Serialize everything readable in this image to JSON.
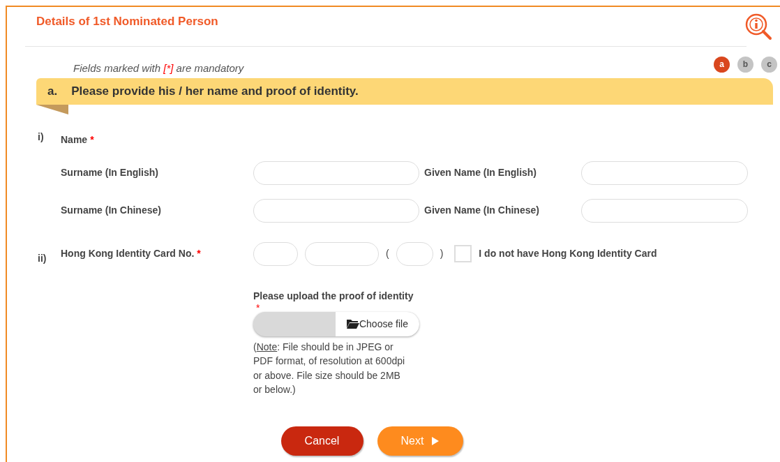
{
  "title": "Details of 1st Nominated Person",
  "mandatory_note": {
    "before": "Fields marked with ",
    "marker": "[*]",
    "after": " are mandatory"
  },
  "steps": [
    {
      "label": "a",
      "selected": true
    },
    {
      "label": "b",
      "selected": false
    },
    {
      "label": "c",
      "selected": false
    }
  ],
  "section": {
    "letter": "a.",
    "heading": "Please provide his / her name and proof of identity."
  },
  "name_group": {
    "number": "i)",
    "label": "Name",
    "required_mark": "*",
    "rows": [
      {
        "label": "Surname (In English)",
        "second_label": "Given Name (In English)"
      },
      {
        "label": "Surname (In Chinese)",
        "second_label": "Given Name (In Chinese)"
      }
    ]
  },
  "id_group": {
    "number": "ii)",
    "label": "Hong Kong Identity Card No.",
    "required_mark": "*",
    "open_paren": "(",
    "close_paren": ")",
    "no_id": {
      "label": "I do not have Hong Kong Identity Card",
      "checked": false
    }
  },
  "upload": {
    "label": "Please upload the proof of identity",
    "required_mark": "*",
    "button": "Choose file",
    "note": {
      "open": "(",
      "label": "Note",
      "body": ": File should be in JPEG or PDF format, of resolution at 600dpi or above. File size should be 2MB or below.)"
    }
  },
  "buttons": [
    {
      "kind": "cancel",
      "label": "Cancel"
    },
    {
      "kind": "next",
      "label": "Next"
    }
  ]
}
